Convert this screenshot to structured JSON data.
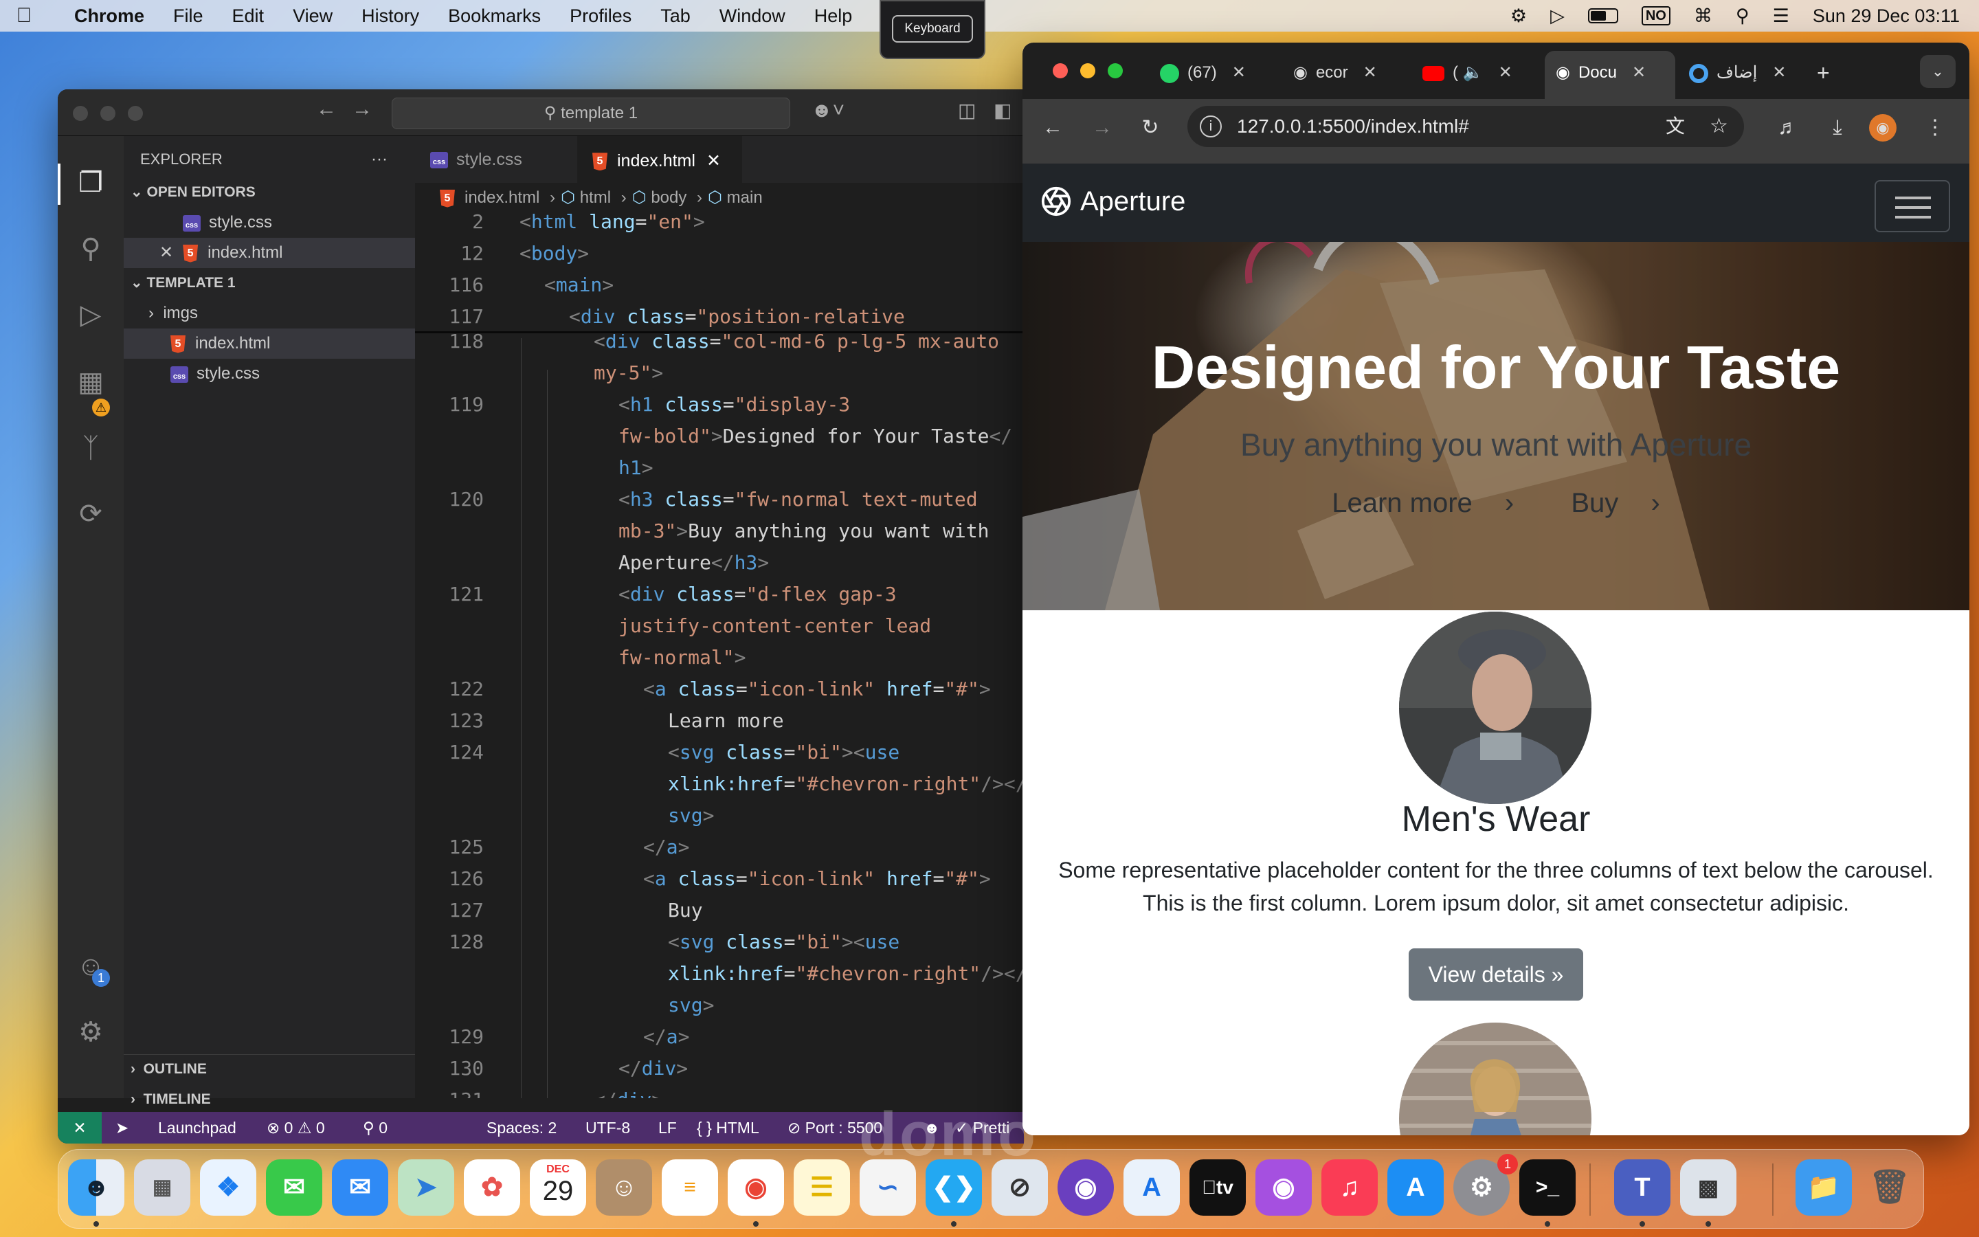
{
  "menubar": {
    "app": "Chrome",
    "items": [
      "File",
      "Edit",
      "View",
      "History",
      "Bookmarks",
      "Profiles",
      "Tab",
      "Window",
      "Help"
    ],
    "keyboard_popup": "Keyboard",
    "input_badge": "NO",
    "clock": "Sun 29 Dec  03:11"
  },
  "vscode": {
    "search": "template 1",
    "sidebar": {
      "explorer": "EXPLORER",
      "more": "···",
      "open_editors": "OPEN EDITORS",
      "open_files": [
        "style.css",
        "index.html"
      ],
      "project": "TEMPLATE 1",
      "folder": "imgs",
      "files": [
        "index.html",
        "style.css"
      ],
      "outline": "OUTLINE",
      "timeline": "TIMELINE"
    },
    "tabs": [
      "style.css",
      "index.html"
    ],
    "breadcrumb": [
      "index.html",
      "html",
      "body",
      "main"
    ],
    "gutter": [
      "2",
      "12",
      "116",
      "117",
      "118",
      "119",
      "120",
      "121",
      "122",
      "123",
      "124",
      "125",
      "126",
      "127",
      "128",
      "129",
      "130",
      "131"
    ],
    "status": {
      "remote": "✕",
      "launchpad": "Launchpad",
      "problems": "⊗ 0 ⚠ 0",
      "ports": "⚲ 0",
      "spaces": "Spaces: 2",
      "encoding": "UTF-8",
      "eol": "LF",
      "language": "{ } HTML",
      "port": "⊘ Port : 5500",
      "prettier": "✓ Pretti"
    },
    "badges": {
      "accounts": "1"
    }
  },
  "chrome": {
    "tabs": [
      "(67)",
      "ecor",
      "(",
      "Docu",
      "إضاف"
    ],
    "new_tab": "+",
    "url": "127.0.0.1:5500/index.html#"
  },
  "page": {
    "brand": "Aperture",
    "hero_title": "Designed for Your Taste",
    "hero_subtitle": "Buy anything you want with Aperture",
    "link_learn": "Learn more",
    "link_buy": "Buy",
    "chevron": "›",
    "col_title": "Men's Wear",
    "col_text": "Some representative placeholder content for the three columns of text below the carousel. This is the first column. Lorem ipsum dolor, sit amet consectetur adipisic.",
    "col_button": "View details »"
  },
  "dock": {
    "calendar_month": "DEC",
    "calendar_day": "29",
    "tv_label": "tv",
    "settings_badge": "1"
  },
  "colors": {
    "vscode_status": "#4d2d6b",
    "navbar": "#212529",
    "button": "#6c757d"
  }
}
